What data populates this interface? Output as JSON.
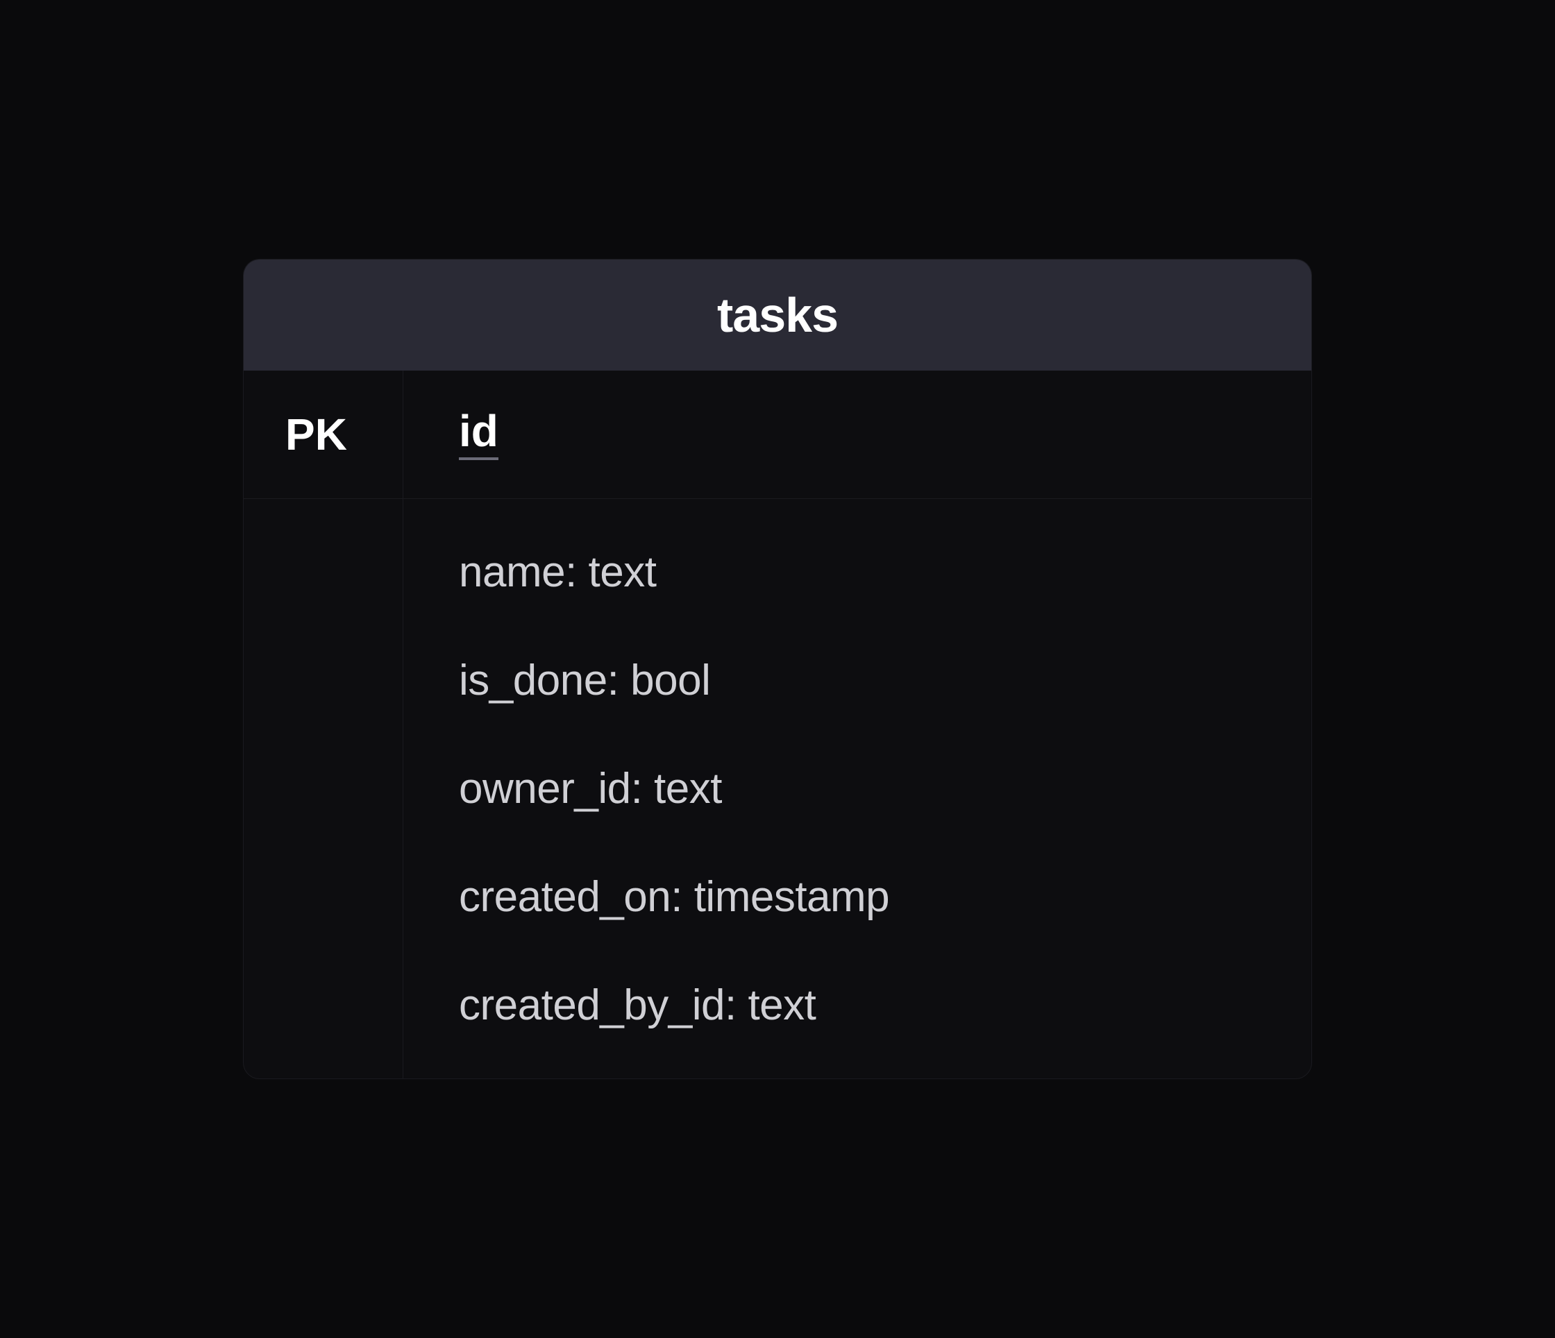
{
  "table": {
    "name": "tasks",
    "primary_key": {
      "label": "PK",
      "column": "id"
    },
    "fields": [
      {
        "name": "name",
        "type": "text"
      },
      {
        "name": "is_done",
        "type": "bool"
      },
      {
        "name": "owner_id",
        "type": "text"
      },
      {
        "name": "created_on",
        "type": "timestamp"
      },
      {
        "name": "created_by_id",
        "type": "text"
      }
    ],
    "field_display": [
      "name: text",
      "is_done: bool",
      "owner_id: text",
      "created_on: timestamp",
      "created_by_id: text"
    ]
  }
}
